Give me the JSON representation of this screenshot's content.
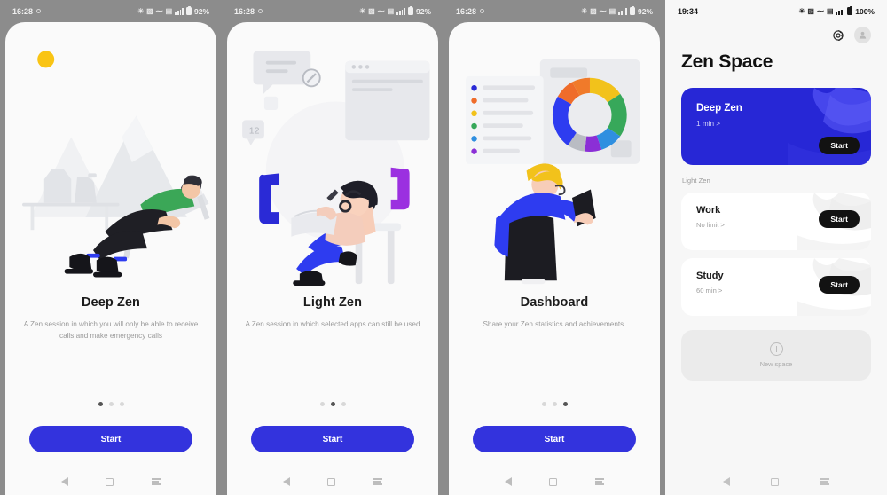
{
  "statusbar": {
    "onboarding_time": "16:28",
    "onboarding_battery": "92%",
    "zen_time": "19:34",
    "zen_battery": "100%"
  },
  "onboarding": [
    {
      "title": "Deep Zen",
      "description": "A Zen session in which you will only be able to receive calls and make emergency calls",
      "button": "Start",
      "active_dot": 0,
      "illustration": "man-relaxing-lounge-chair-mountains"
    },
    {
      "title": "Light Zen",
      "description": "A Zen session in which selected apps can still be used",
      "button": "Start",
      "active_dot": 1,
      "illustration": "woman-headphones-stool-tablet"
    },
    {
      "title": "Dashboard",
      "description": "Share your Zen statistics and achievements.",
      "button": "Start",
      "active_dot": 2,
      "illustration": "person-viewing-donut-chart-dashboard"
    }
  ],
  "zen_space": {
    "page_title": "Zen Space",
    "gear_icon": "gear-icon",
    "avatar_icon": "avatar-icon",
    "deep_zen": {
      "title": "Deep Zen",
      "duration": "1 min  >",
      "start_label": "Start"
    },
    "section_label": "Light Zen",
    "spaces": [
      {
        "title": "Work",
        "duration": "No limit  >",
        "start_label": "Start"
      },
      {
        "title": "Study",
        "duration": "60 min  >",
        "start_label": "Start"
      }
    ],
    "new_space": {
      "label": "New space",
      "icon": "plus-circle-icon"
    }
  },
  "navbar": {
    "back": "back-icon",
    "home": "home-icon",
    "recents": "recents-icon"
  },
  "colors": {
    "accent_blue": "#3333dd",
    "card_blue": "#2727d6",
    "pill_black": "#121212",
    "panel_bg": "#fafafa",
    "zen_bg": "#f7f7f7"
  }
}
